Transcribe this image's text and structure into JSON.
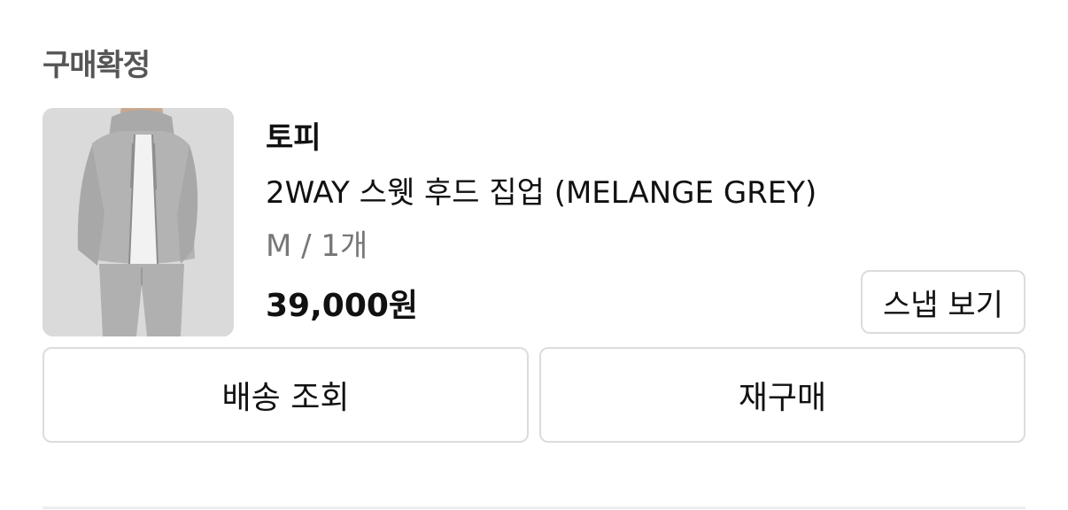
{
  "order": {
    "status": "구매확정"
  },
  "product": {
    "image_icon": "hoodie-product-photo",
    "brand": "토피",
    "name": "2WAY 스웻 후드 집업 (MELANGE GREY)",
    "option": "M / 1개",
    "price": "39,000원"
  },
  "buttons": {
    "snap": "스냅 보기",
    "delivery": "배송 조회",
    "rebuy": "재구매"
  },
  "colors": {
    "status_text": "#555555",
    "option_text": "#777777",
    "border": "#dcdcdc",
    "image_bg": "#d8d8d8"
  }
}
